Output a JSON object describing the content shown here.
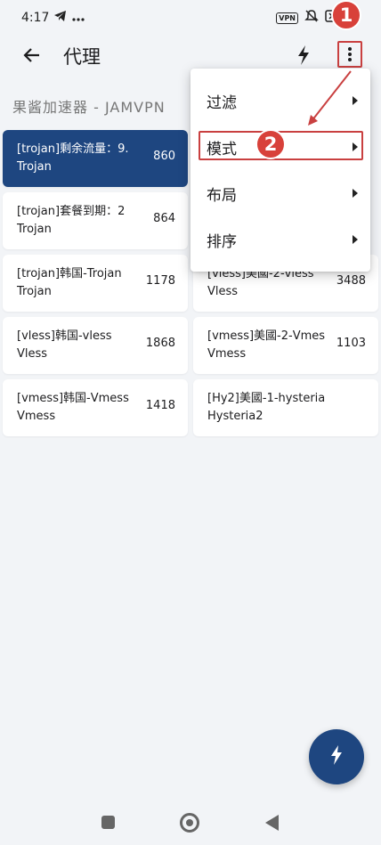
{
  "status_bar": {
    "time": "4:17",
    "vpn_badge": "VPN",
    "icons": [
      "telegram-icon",
      "more-dots-icon",
      "vpn-icon",
      "mute-icon",
      "data-off-icon",
      "wifi-icon",
      "battery-icon"
    ]
  },
  "app_bar": {
    "title": "代理",
    "icons": [
      "back-arrow-icon",
      "bolt-icon",
      "more-vert-icon"
    ]
  },
  "group": {
    "header": "果酱加速器 - JAMVPN"
  },
  "proxies": [
    {
      "name": "[trojan]剩余流量：9.",
      "type": "Trojan",
      "latency": "860",
      "selected": true
    },
    {
      "name": "[trojan]套餐到期：2",
      "type": "Trojan",
      "latency": "864"
    },
    {
      "name": "[trojan]韩国-Trojan",
      "type": "Trojan",
      "latency": "1178"
    },
    {
      "name": "[vless]美國-2-vless",
      "type": "Vless",
      "latency": "3488"
    },
    {
      "name": "[vless]韩国-vless",
      "type": "Vless",
      "latency": "1868"
    },
    {
      "name": "[vmess]美國-2-Vmes",
      "type": "Vmess",
      "latency": "1103"
    },
    {
      "name": "[vmess]韩国-Vmess",
      "type": "Vmess",
      "latency": "1418"
    },
    {
      "name": "[Hy2]美國-1-hysteria",
      "type": "Hysteria2",
      "latency": ""
    }
  ],
  "menu": {
    "items": [
      {
        "label": "过滤"
      },
      {
        "label": "模式"
      },
      {
        "label": "布局"
      },
      {
        "label": "排序"
      }
    ]
  },
  "annotations": {
    "badge_1": "1",
    "badge_2": "2",
    "color": "#d8413a"
  },
  "colors": {
    "accent": "#1e4680",
    "background": "#f2f4f7",
    "card": "#ffffff"
  }
}
